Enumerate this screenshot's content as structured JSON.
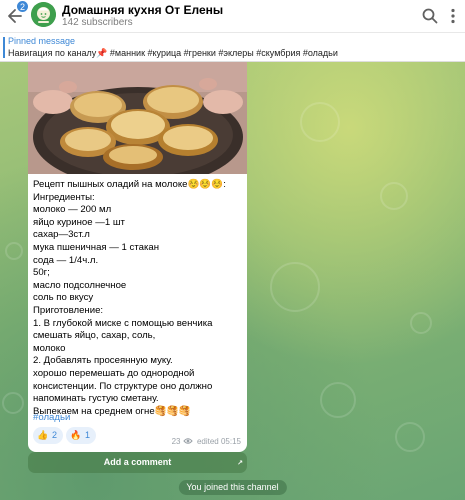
{
  "header": {
    "unread_count": "2",
    "title": "Домашняя кухня От Елены",
    "subscribers": "142 subscribers",
    "icons": [
      "back-arrow-icon",
      "search-icon",
      "more-vertical-icon"
    ]
  },
  "pinned": {
    "label": "Pinned message",
    "text": "Навигация по каналу📌 #манник #курица #гренки #эклеры #скумбрия #оладьи"
  },
  "post": {
    "text": "Рецепт пышных оладий на молоке☺️☺️☺️:\nИнгредиенты:\nмолоко — 200 мл\nяйцо куриное —1 шт\nсахар—3ст.л\nмука пшеничная — 1 стакан\nсода — 1/4ч.л.\n50г;\nмасло подсолнечное\nсоль по вкусу\nПриготовление:\n1. В глубокой миске с помощью венчика смешать яйцо, сахар, соль,\nмолоко\n2. Добавлять просеянную муку.\nхорошо перемешать до однородной консистенции. По структуре оно должно напоминать густую сметану.\nВыпекаем на среднем огне🥞🥞🥞",
    "hashtag": "#оладьи",
    "reactions": [
      {
        "emoji": "👍",
        "count": "2"
      },
      {
        "emoji": "🔥",
        "count": "1"
      }
    ],
    "views": "23",
    "edited": "edited 05:15"
  },
  "comment": {
    "label": "Add a comment"
  },
  "system": {
    "joined": "You joined this channel"
  },
  "colors": {
    "accent": "#3e88d6",
    "avatar": "#3e9f4d"
  }
}
